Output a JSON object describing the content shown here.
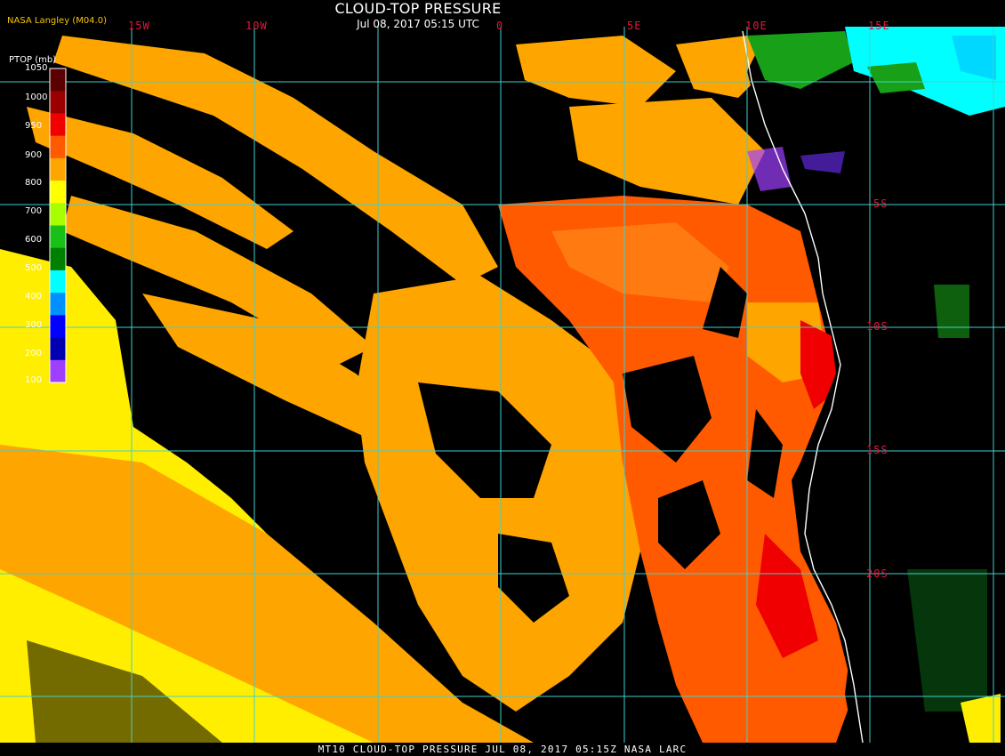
{
  "header": {
    "title": "CLOUD-TOP PRESSURE",
    "datetime": "Jul 08, 2017 05:15 UTC",
    "credit": "NASA Langley (M04.0)"
  },
  "legend": {
    "title": "PTOP (mb)",
    "ticks": [
      "1050",
      "1000",
      "950",
      "900",
      "800",
      "700",
      "600",
      "500",
      "400",
      "300",
      "200",
      "100"
    ],
    "colors": [
      "#5a0000",
      "#9a0000",
      "#f00000",
      "#ff5a00",
      "#ffa500",
      "#ffff00",
      "#a8ff00",
      "#18c018",
      "#008000",
      "#00ffff",
      "#0090ff",
      "#0000ff",
      "#0000b0",
      "#a040ff"
    ]
  },
  "grid": {
    "lon_labels": [
      "15W",
      "10W",
      "0",
      "5E",
      "10E",
      "15E"
    ],
    "lat_labels": [
      "5S",
      "10S",
      "15S",
      "20S"
    ]
  },
  "footer": {
    "text": "MT10   CLOUD-TOP PRESSURE   JUL 08, 2017 05:15Z   NASA LARC"
  }
}
